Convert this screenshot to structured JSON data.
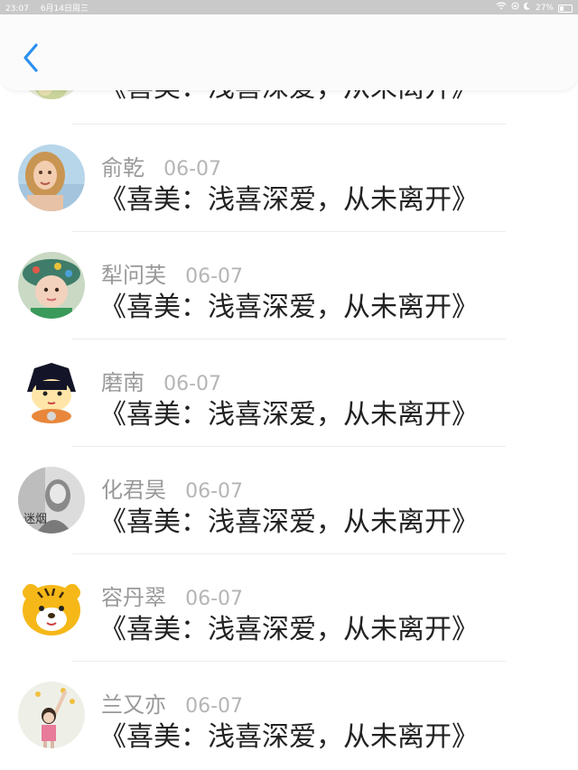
{
  "status_bar": {
    "time": "23:07",
    "date": "6月14日周三",
    "battery": "27%"
  },
  "header": {
    "back_icon": "chevron-left-icon",
    "accent_color": "#2a8ff0"
  },
  "items": [
    {
      "name": "",
      "date": "",
      "content": "《喜美：浅喜深爱，从未离开》",
      "avatar": "flower-avatar"
    },
    {
      "name": "俞乾",
      "date": "06-07",
      "content": "《喜美：浅喜深爱，从未离开》",
      "avatar": "blonde-girl-avatar"
    },
    {
      "name": "犁问芙",
      "date": "06-07",
      "content": "《喜美：浅喜深爱，从未离开》",
      "avatar": "child-in-hat-avatar"
    },
    {
      "name": "磨南",
      "date": "06-07",
      "content": "《喜美：浅喜深爱，从未离开》",
      "avatar": "anime-ninja-avatar"
    },
    {
      "name": "化君昊",
      "date": "06-07",
      "content": "《喜美：浅喜深爱，从未离开》",
      "avatar": "bw-photo-avatar",
      "avatar_text": "迷烟"
    },
    {
      "name": "容丹翠",
      "date": "06-07",
      "content": "《喜美：浅喜深爱，从未离开》",
      "avatar": "tiger-cartoon-avatar"
    },
    {
      "name": "兰又亦",
      "date": "06-07",
      "content": "《喜美：浅喜深爱，从未离开》",
      "avatar": "little-girl-photo-avatar"
    }
  ]
}
